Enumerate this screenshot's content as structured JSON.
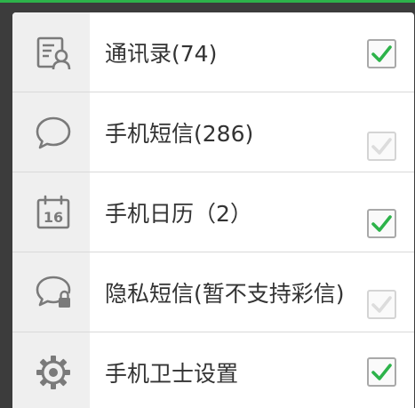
{
  "accent_color": "#2db34a",
  "items": [
    {
      "label": "通讯录(74)",
      "icon": "contacts-icon",
      "checked": true,
      "enabled": true
    },
    {
      "label": "手机短信(286)",
      "icon": "sms-bubble-icon",
      "checked": true,
      "enabled": false
    },
    {
      "label": "手机日历（2）",
      "icon": "calendar-icon",
      "checked": true,
      "enabled": true
    },
    {
      "label": "隐私短信(暂不支持彩信)",
      "icon": "private-sms-lock-icon",
      "checked": true,
      "enabled": false
    },
    {
      "label": "手机卫士设置",
      "icon": "settings-gear-icon",
      "checked": true,
      "enabled": true
    }
  ]
}
